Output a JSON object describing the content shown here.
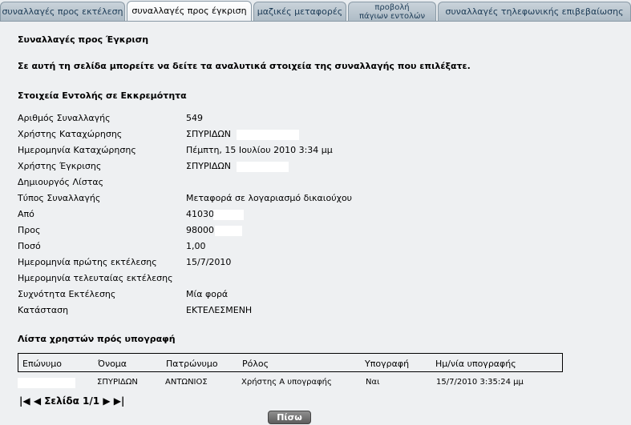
{
  "tabs": [
    {
      "label": "συναλλαγές προς εκτέλεση"
    },
    {
      "label": "συναλλαγές προς έγκριση"
    },
    {
      "label": "μαζικές μεταφορές"
    },
    {
      "label_line1": "προβολή",
      "label_line2": "πάγιων εντολών"
    },
    {
      "label": "συναλλαγές τηλεφωνικής επιβεβαίωσης"
    }
  ],
  "page": {
    "title": "Συναλλαγές προς Έγκριση",
    "intro": "Σε αυτή τη σελίδα μπορείτε να δείτε τα αναλυτικά στοιχεία της συναλλαγής που επιλέξατε.",
    "section_title": "Στοιχεία Εντολής σε Εκκρεμότητα"
  },
  "details": [
    {
      "label": "Αριθμός Συναλλαγής",
      "value": "549"
    },
    {
      "label": "Χρήστης Καταχώρησης",
      "value": "ΣΠΥΡΙΔΩΝ"
    },
    {
      "label": "Ημερομηνία Καταχώρησης",
      "value": "Πέμπτη, 15 Ιουλίου 2010 3:34 μμ"
    },
    {
      "label": "Χρήστης Έγκρισης",
      "value": "ΣΠΥΡΙΔΩΝ"
    },
    {
      "label": "Δημιουργός Λίστας",
      "value": ""
    },
    {
      "label": "Τύπος Συναλλαγής",
      "value": "Μεταφορά σε λογαριασμό δικαιούχου"
    },
    {
      "label": "Από",
      "value": "41030"
    },
    {
      "label": "Προς",
      "value": "98000"
    },
    {
      "label": "Ποσό",
      "value": "1,00"
    },
    {
      "label": "Ημερομηνία πρώτης εκτέλεσης",
      "value": "15/7/2010"
    },
    {
      "label": "Ημερομηνία τελευταίας εκτέλεσης",
      "value": ""
    },
    {
      "label": "Συχνότητα Εκτέλεσης",
      "value": "Μία φορά"
    },
    {
      "label": "Κατάσταση",
      "value": "ΕΚΤΕΛΕΣΜΕΝΗ"
    }
  ],
  "signers": {
    "title": "Λίστα χρηστών πρός υπογραφή",
    "headers": [
      "Επώνυμο",
      "Όνομα",
      "Πατρώνυμο",
      "Ρόλος",
      "Υπογραφή",
      "Ημ/νία υπογραφής"
    ],
    "rows": [
      {
        "surname": "",
        "name": "ΣΠΥΡΙΔΩΝ",
        "father": "ΑΝΤΩΝΙΟΣ",
        "role": "Χρήστης Α υπογραφής",
        "signed": "Ναι",
        "date": "15/7/2010 3:35:24 μμ"
      }
    ]
  },
  "pager": {
    "label": "Σελίδα 1/1"
  },
  "back_button": {
    "label": "Πίσω"
  }
}
